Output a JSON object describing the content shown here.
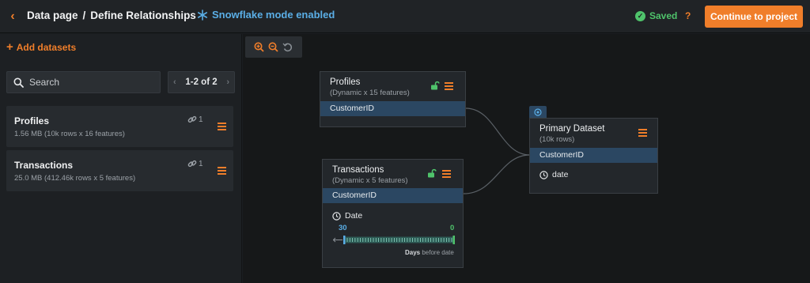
{
  "header": {
    "breadcrumb_parent": "Data page",
    "breadcrumb_sep": "/",
    "breadcrumb_current": "Define Relationships",
    "snowflake_label": "Snowflake mode enabled",
    "saved_label": "Saved",
    "help_label": "?",
    "continue_label": "Continue to project"
  },
  "sidebar": {
    "add_label": "Add datasets",
    "search_placeholder": "Search",
    "pager_label": "1-2 of 2",
    "datasets": [
      {
        "name": "Profiles",
        "meta": "1.56 MB (10k rows x 16 features)",
        "links": "1"
      },
      {
        "name": "Transactions",
        "meta": "25.0 MB (412.46k rows x 5 features)",
        "links": "1"
      }
    ]
  },
  "canvas": {
    "nodes": {
      "profiles": {
        "title": "Profiles",
        "subtitle": "(Dynamic x 15 features)",
        "key": "CustomerID"
      },
      "transactions": {
        "title": "Transactions",
        "subtitle": "(Dynamic x 5 features)",
        "key": "CustomerID",
        "date_label": "Date",
        "window_start": "30",
        "window_end": "0",
        "caption_bold": "Days",
        "caption_rest": "before date"
      },
      "primary": {
        "title": "Primary Dataset",
        "subtitle": "(10k rows)",
        "key": "CustomerID",
        "date_label": "date"
      }
    }
  },
  "colors": {
    "accent": "#f07e2a",
    "snowflake": "#5aaee6",
    "saved": "#4fc36b",
    "key_row": "#2b4762"
  },
  "icons": {
    "back": "chevron-left-icon",
    "snowflake": "snowflake-icon",
    "saved": "check-circle-icon",
    "search": "search-icon",
    "link": "link-icon",
    "menu": "hamburger-menu-icon",
    "zoom_in": "zoom-in-icon",
    "zoom_out": "zoom-out-icon",
    "reset": "reset-icon",
    "unlock": "unlock-icon",
    "primary": "target-icon",
    "clock": "clock-icon"
  }
}
